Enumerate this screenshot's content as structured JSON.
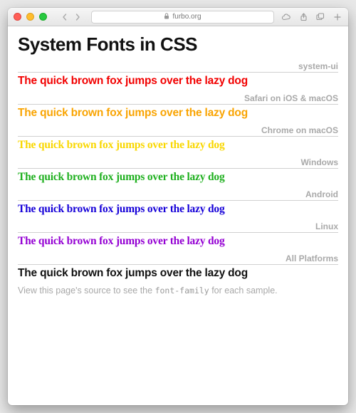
{
  "browser": {
    "url": "furbo.org"
  },
  "page": {
    "title": "System Fonts in CSS",
    "sample_text": "The quick brown fox jumps over the lazy dog",
    "sections": [
      {
        "label": "system-ui",
        "class": "s-red"
      },
      {
        "label": "Safari on iOS & macOS",
        "class": "s-orange"
      },
      {
        "label": "Chrome on macOS",
        "class": "s-yellow"
      },
      {
        "label": "Windows",
        "class": "s-green"
      },
      {
        "label": "Android",
        "class": "s-blue"
      },
      {
        "label": "Linux",
        "class": "s-purple"
      },
      {
        "label": "All Platforms",
        "class": "s-black"
      }
    ],
    "footer_prefix": "View this page's source to see the ",
    "footer_code": "font-family",
    "footer_suffix": " for each sample."
  }
}
